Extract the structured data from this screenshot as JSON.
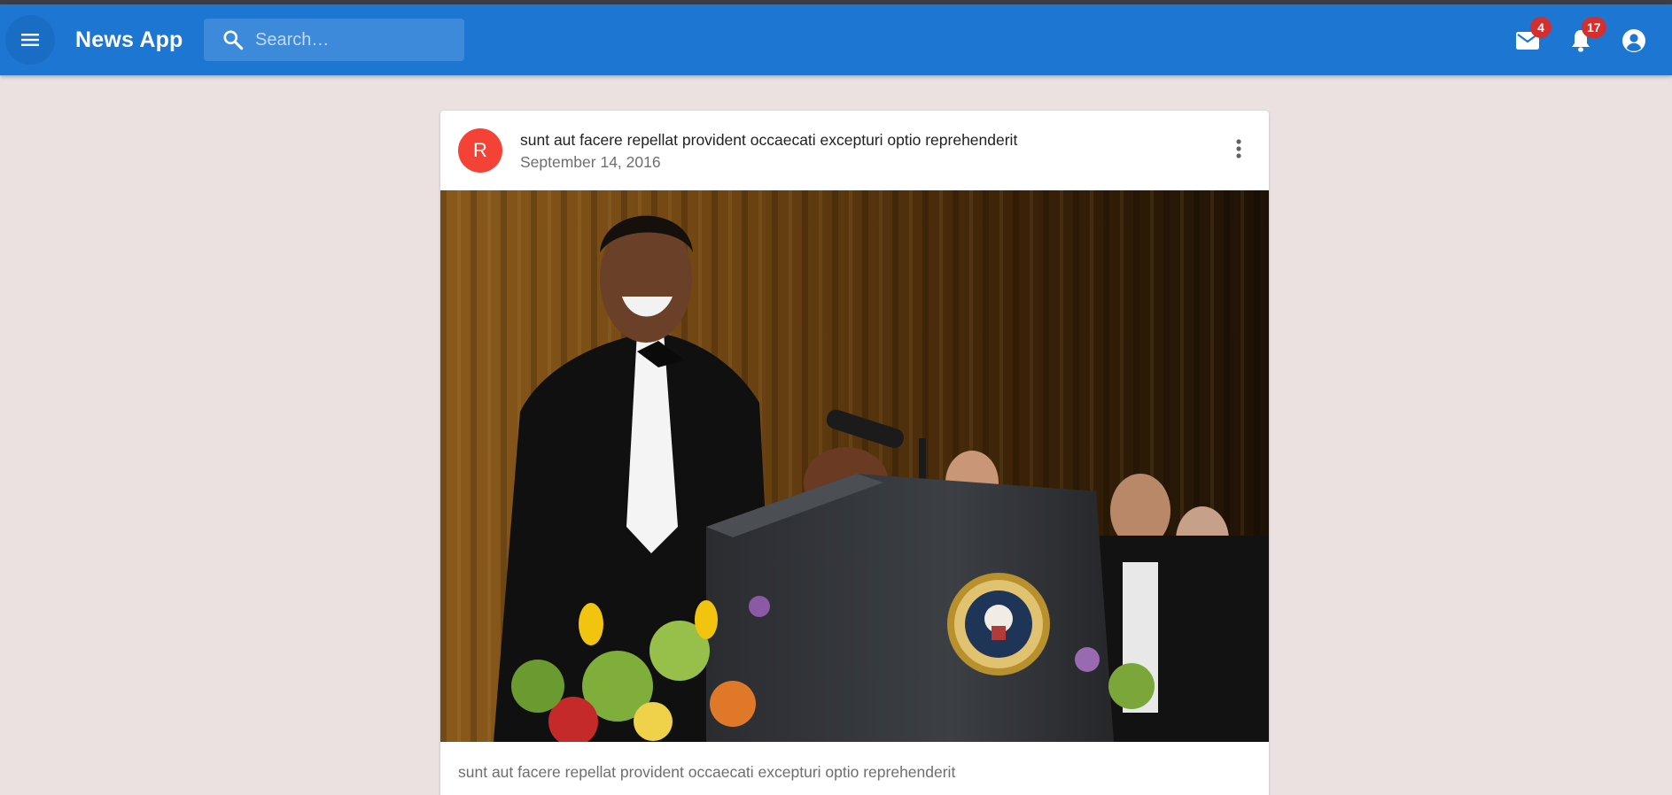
{
  "appbar": {
    "title": "News App",
    "menu_icon": "hamburger-menu-icon",
    "search": {
      "placeholder": "Search…",
      "value": ""
    },
    "mail": {
      "icon": "mail-icon",
      "badge": "4"
    },
    "notifications": {
      "icon": "bell-icon",
      "badge": "17"
    },
    "account": {
      "icon": "account-circle-icon"
    },
    "color": "#1c76d2"
  },
  "post": {
    "avatar_letter": "R",
    "avatar_color": "#f44336",
    "title": "sunt aut facere repellat provident occaecati excepturi optio reprehenderit",
    "date": "September 14, 2016",
    "more_icon": "more-vert-icon",
    "body": "sunt aut facere repellat provident occaecati excepturi optio reprehenderit"
  }
}
